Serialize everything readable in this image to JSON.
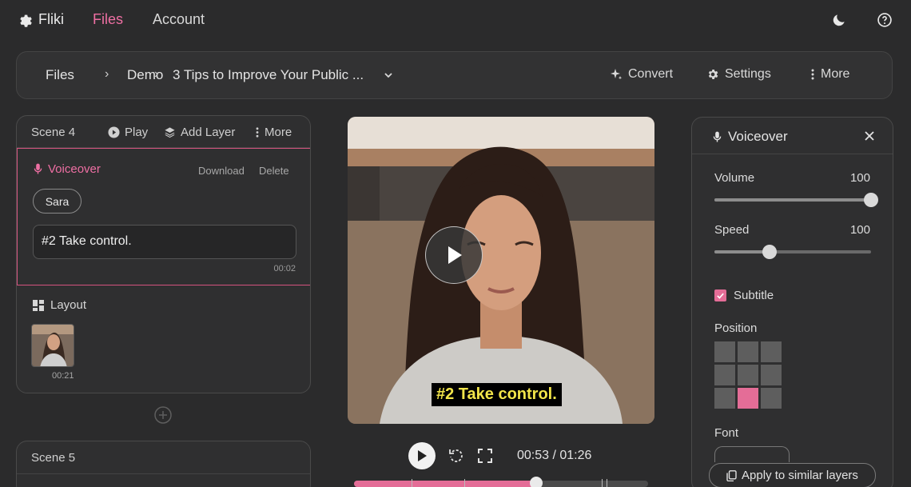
{
  "nav": {
    "brand": "Fliki",
    "files": "Files",
    "account": "Account",
    "icons": [
      "gear-icon",
      "moon-icon",
      "help-icon"
    ]
  },
  "toolbar": {
    "breadcrumb": [
      "Files",
      "Demo",
      "3 Tips to Improve Your Public ..."
    ],
    "convert": "Convert",
    "settings": "Settings",
    "more": "More"
  },
  "scene4": {
    "title": "Scene 4",
    "play": "Play",
    "add_layer": "Add Layer",
    "more": "More",
    "voiceover": {
      "label": "Voiceover",
      "download": "Download",
      "delete": "Delete",
      "voice": "Sara",
      "text": "#2 Take control.",
      "duration": "00:02"
    },
    "layout": {
      "label": "Layout",
      "duration": "00:21"
    }
  },
  "scene5": {
    "title": "Scene 5"
  },
  "player": {
    "subtitle": "#2 Take control.",
    "time": "00:53 / 01:26",
    "progress": 0.62
  },
  "panel": {
    "title": "Voiceover",
    "volume_label": "Volume",
    "volume_value": "100",
    "volume": 1.0,
    "speed_label": "Speed",
    "speed_value": "100",
    "speed": 0.35,
    "subtitle_label": "Subtitle",
    "subtitle_checked": true,
    "position_label": "Position",
    "position_selected": 7,
    "font_label": "Font",
    "apply": "Apply to similar layers"
  },
  "colors": {
    "accent": "#e46d97",
    "background": "#2b2b2c",
    "subtitle_text": "#f2e54a"
  }
}
